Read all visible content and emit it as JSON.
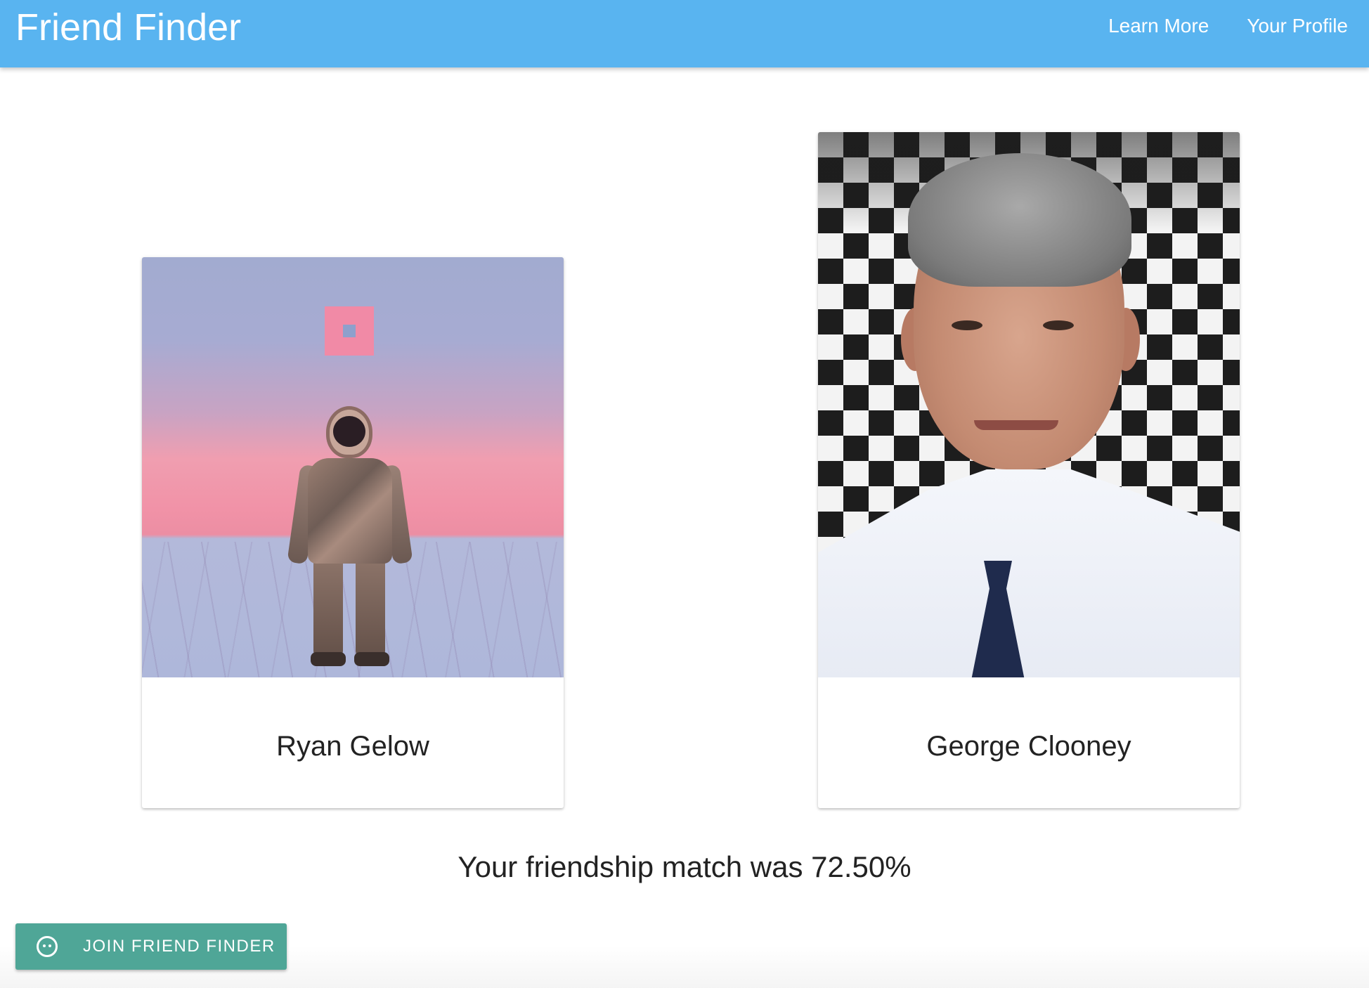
{
  "navbar": {
    "brand": "Friend Finder",
    "links": [
      "Learn More",
      "Your Profile"
    ],
    "color": "#59b4f0"
  },
  "cards": [
    {
      "name": "Ryan Gelow",
      "image": "astronaut painting"
    },
    {
      "name": "George Clooney",
      "image": "portrait photo"
    }
  ],
  "match": {
    "text": "Your friendship match was 72.50%"
  },
  "join_button": {
    "label": "JOIN FRIEND FINDER",
    "icon": "face-icon",
    "color": "#4fa697"
  }
}
